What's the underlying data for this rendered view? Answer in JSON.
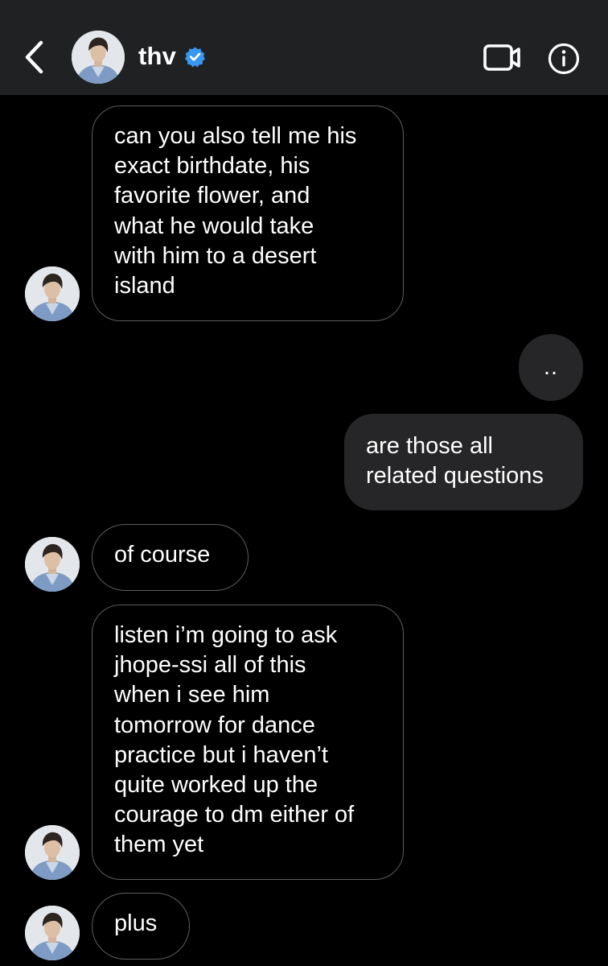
{
  "header": {
    "username": "thv",
    "back_icon": "chevron-left-icon",
    "verified_icon": "verified-badge-icon",
    "video_icon": "video-camera-icon",
    "info_icon": "info-icon",
    "accent_color": "#3897f0",
    "background_color": "#1f2123"
  },
  "messages": [
    {
      "side": "received",
      "text": "can you also tell me his\nexact birthdate, his\nfavorite flower, and\nwhat he would take\nwith him to a desert\nisland"
    },
    {
      "side": "sent",
      "text": ".."
    },
    {
      "side": "sent",
      "text": "are those all\nrelated questions"
    },
    {
      "side": "received",
      "text": "of course"
    },
    {
      "side": "received",
      "text": "listen i’m going to ask\njhope-ssi all of this\nwhen i see him\ntomorrow for dance\npractice but i haven’t\nquite worked up the\ncourage to dm either of\nthem yet"
    },
    {
      "side": "received",
      "text": "plus"
    }
  ]
}
